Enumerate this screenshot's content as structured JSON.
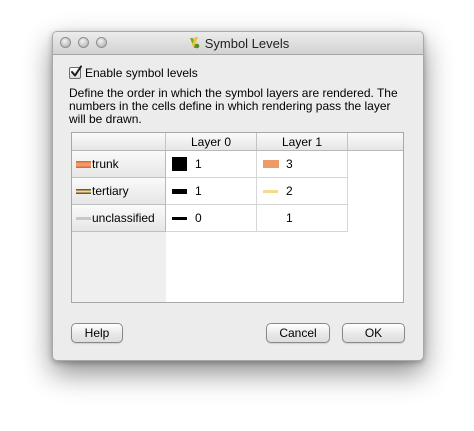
{
  "window": {
    "title": "Symbol Levels"
  },
  "enable": {
    "label": "Enable symbol levels",
    "checked": true
  },
  "description": "Define the order in which the symbol layers are rendered. The numbers in the cells define in which rendering pass the layer will be drawn.",
  "table": {
    "columns": [
      "Layer 0",
      "Layer 1"
    ],
    "rows": [
      {
        "label": "trunk",
        "icon": "trunk-line-swatch",
        "cells": [
          {
            "value": "1",
            "symbol_color": "#000000",
            "symbol": "square"
          },
          {
            "value": "3",
            "symbol_color": "#f09a68",
            "symbol": "wide-bar"
          }
        ]
      },
      {
        "label": "tertiary",
        "icon": "tertiary-line-swatch",
        "cells": [
          {
            "value": "1",
            "symbol_color": "#000000",
            "symbol": "thick-line"
          },
          {
            "value": "2",
            "symbol_color": "#f7d98c",
            "symbol": "thin-line"
          }
        ]
      },
      {
        "label": "unclassified",
        "icon": "unclassified-line-swatch",
        "cells": [
          {
            "value": "0",
            "symbol_color": "#000000",
            "symbol": "thin-line"
          },
          {
            "value": "1",
            "symbol_color": "#ffffff",
            "symbol": "none"
          }
        ]
      }
    ]
  },
  "buttons": {
    "help": "Help",
    "cancel": "Cancel",
    "ok": "OK"
  },
  "colors": {
    "trunk_fill": "#f09a68",
    "tertiary_fill": "#f7d98c",
    "unclassified_fill": "#d8d8d8"
  }
}
